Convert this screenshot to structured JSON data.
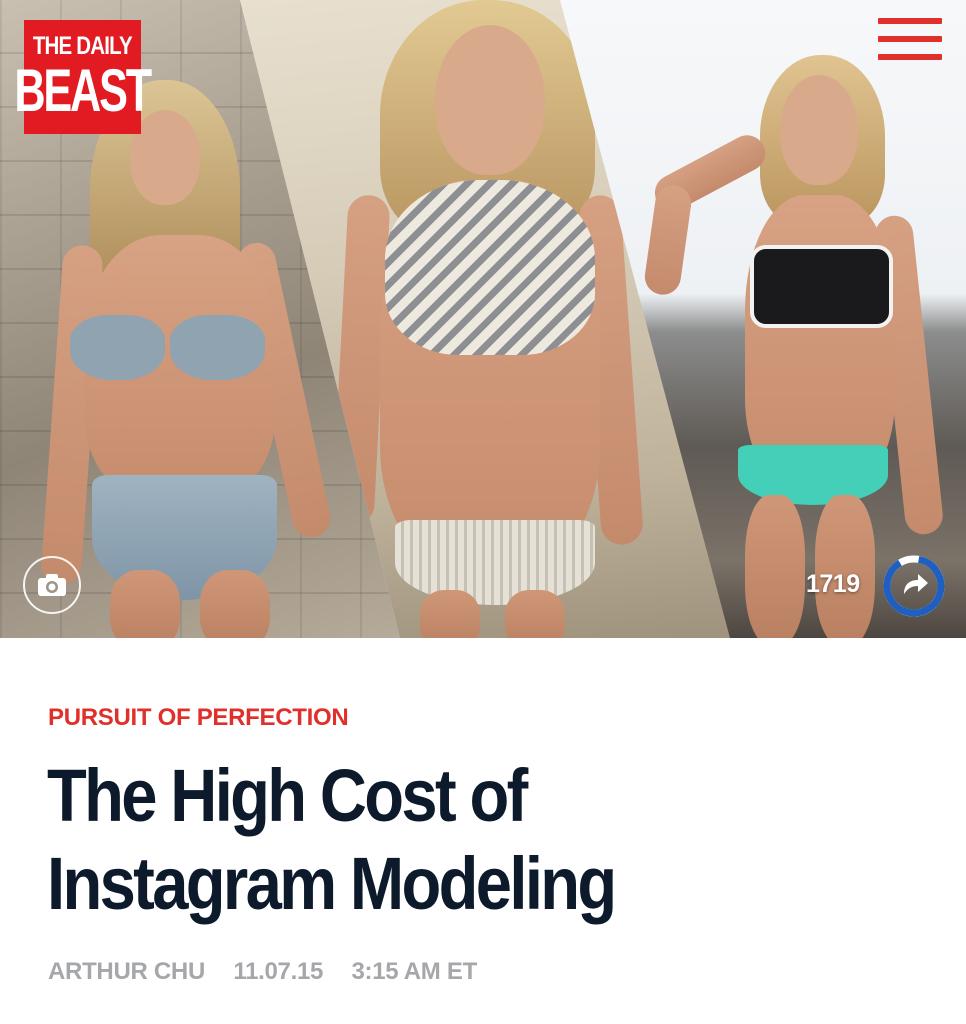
{
  "brand": {
    "logo_line1": "THE DAILY",
    "logo_line2": "BEAST",
    "brand_color": "#e21b23"
  },
  "header": {
    "menu_icon": "hamburger-menu-icon",
    "menu_color": "#e0302c"
  },
  "hero": {
    "camera_icon": "camera-icon",
    "share_count": "1719",
    "share_icon": "share-arrow-icon",
    "share_ring_color": "#1f5fbf"
  },
  "article": {
    "kicker": "PURSUIT OF PERFECTION",
    "kicker_color": "#e0302c",
    "headline": "The High Cost of Instagram Modeling",
    "author": "ARTHUR CHU",
    "date": "11.07.15",
    "time": "3:15 AM ET"
  }
}
